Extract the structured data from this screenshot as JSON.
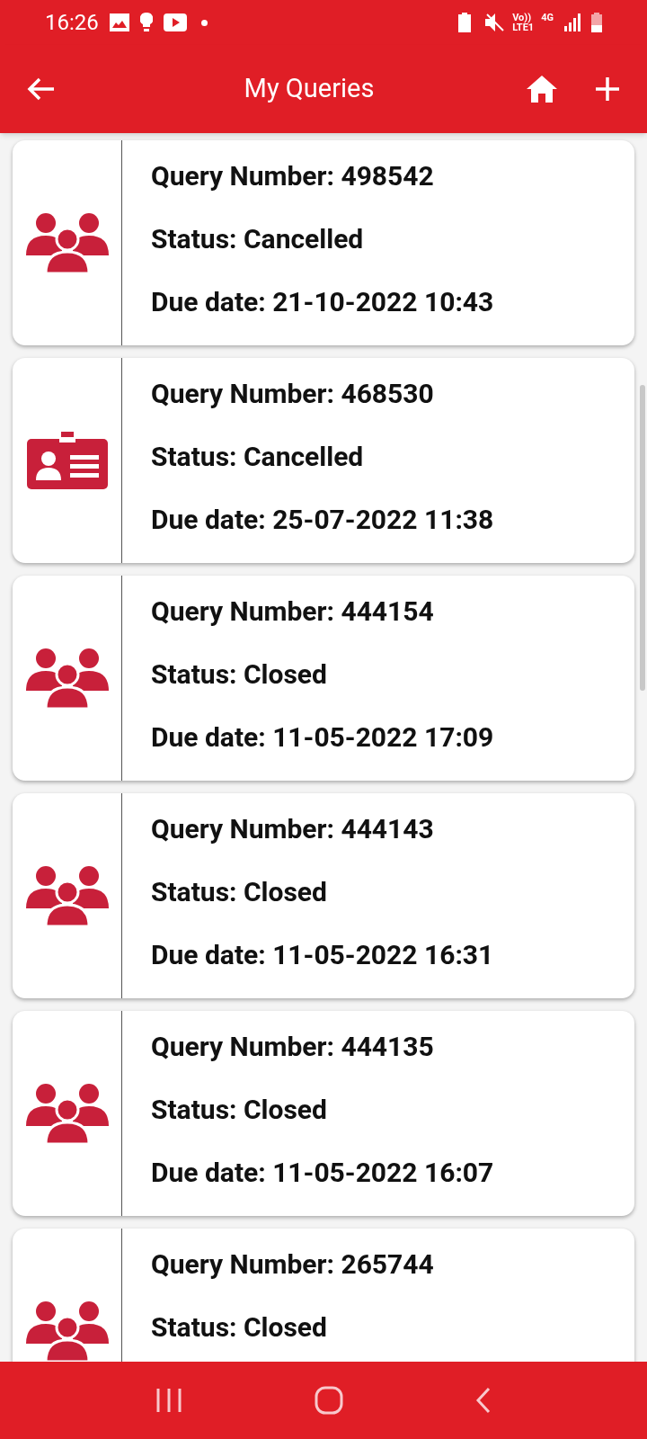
{
  "status_bar": {
    "time": "16:26",
    "volte": "Vo))",
    "lte": "LTE1",
    "network": "4G"
  },
  "header": {
    "title": "My Queries"
  },
  "queries": [
    {
      "kind": "group",
      "number": "Query Number: 498542",
      "status": "Status: Cancelled",
      "due": "Due date: 21-10-2022 10:43"
    },
    {
      "kind": "id-card",
      "number": "Query Number: 468530",
      "status": "Status: Cancelled",
      "due": "Due date: 25-07-2022 11:38"
    },
    {
      "kind": "group",
      "number": "Query Number: 444154",
      "status": "Status: Closed",
      "due": "Due date: 11-05-2022 17:09"
    },
    {
      "kind": "group",
      "number": "Query Number: 444143",
      "status": "Status: Closed",
      "due": "Due date: 11-05-2022 16:31"
    },
    {
      "kind": "group",
      "number": "Query Number: 444135",
      "status": "Status: Closed",
      "due": "Due date: 11-05-2022 16:07"
    },
    {
      "kind": "group",
      "number": "Query Number: 265744",
      "status": "Status: Closed"
    }
  ]
}
